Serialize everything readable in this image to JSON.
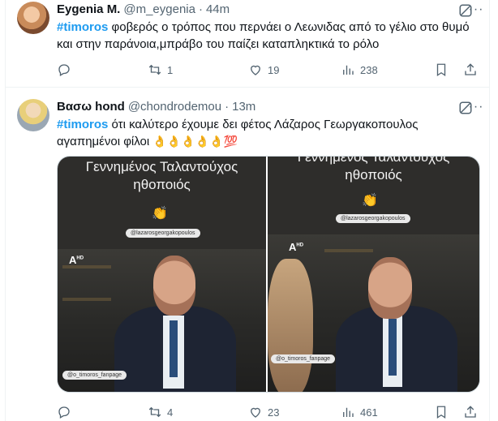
{
  "tweets": [
    {
      "name": "Eygenia M.",
      "handle": "@m_eygenia",
      "time": "44m",
      "hashtag": "#timoros",
      "text": " φοβερός ο τρόπος που περνάει ο Λεωνιδας από το γέλιο στο θυμό και στην παράνοια,μπράβο του παίζει καταπληκτικά το ρόλο",
      "reply_count": "",
      "retweet_count": "1",
      "like_count": "19",
      "view_count": "238"
    },
    {
      "name": "Βασω hond",
      "handle": "@chondrodemou",
      "time": "13m",
      "hashtag": "#timoros",
      "text": " ότι καλύτερο  έχουμε  δει  φέτος  Λάζαρος  Γεωργακοπουλος αγαπημένοι φίλοι ",
      "emojis": "👌👌👌👌👌💯",
      "reply_count": "",
      "retweet_count": "4",
      "like_count": "23",
      "view_count": "461",
      "media": {
        "left_caption_line1": "Γεννημένος Ταλαντούχος",
        "left_caption_line2": "ηθοποιός",
        "right_caption_line1": "Γεννημένος Ταλαντούχος",
        "right_caption_line2": "ηθοποιός",
        "clap": "👏",
        "instagram_tag": "@lazarosgeorgakopoulos",
        "fanpage_tag": "@o_timoros_fanpage",
        "channel_logo": "A",
        "channel_hd": "HD"
      }
    }
  ],
  "colors": {
    "accent": "#1d9bf0",
    "muted": "#536471",
    "text": "#0f1419"
  },
  "icons": [
    "reply-icon",
    "retweet-icon",
    "like-icon",
    "views-icon",
    "bookmark-icon",
    "share-icon",
    "grok-icon",
    "more-icon"
  ]
}
